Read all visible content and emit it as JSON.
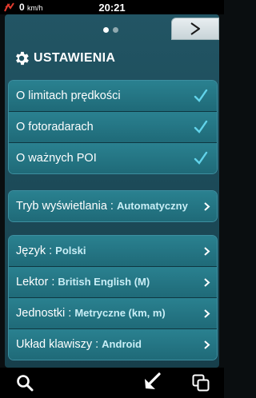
{
  "status": {
    "speed": "0",
    "speed_unit": "km/h",
    "time": "20:21"
  },
  "header": {
    "title": "USTAWIENIA",
    "icon": "gear-icon"
  },
  "group1": [
    {
      "label": "O limitach prędkości",
      "checked": true
    },
    {
      "label": "O fotoradarach",
      "checked": true
    },
    {
      "label": "O ważnych POI",
      "checked": true
    }
  ],
  "display_mode": {
    "label": "Tryb wyświetlania : ",
    "value": "Automatyczny"
  },
  "group3": [
    {
      "label": "Język : ",
      "value": "Polski"
    },
    {
      "label": "Lektor : ",
      "value": "British English (M)"
    },
    {
      "label": "Jednostki : ",
      "value": "Metryczne (km, m)"
    },
    {
      "label": "Układ klawiszy : ",
      "value": "Android"
    }
  ],
  "bottom": {
    "search_icon": "search-icon",
    "back_icon": "back-arrow-icon",
    "windows_icon": "windows-icon"
  },
  "colors": {
    "accent": "#62d3ea",
    "panel": "#1c4a58"
  }
}
